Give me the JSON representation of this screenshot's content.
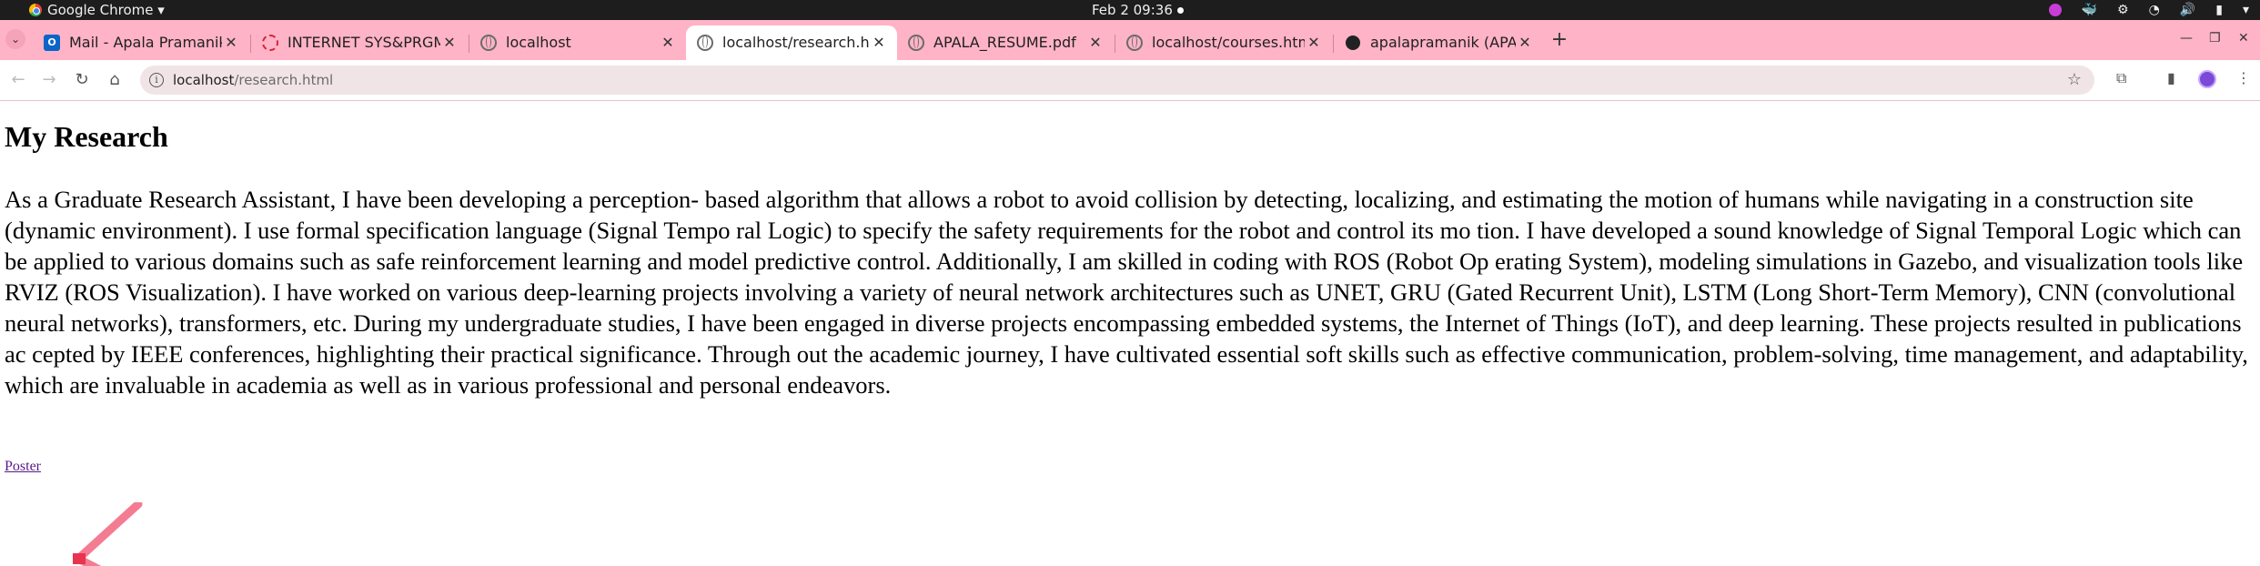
{
  "system_bar": {
    "app_name": "Google Chrome ▾",
    "clock": "Feb 2  09:36"
  },
  "tabs": [
    {
      "title": "Mail - Apala Pramanik - O",
      "icon": "outlook-icon"
    },
    {
      "title": "INTERNET SYS&PRGMMI",
      "icon": "ring-icon"
    },
    {
      "title": "localhost",
      "icon": "globe-icon"
    },
    {
      "title": "localhost/research.html",
      "icon": "globe-icon",
      "active": true
    },
    {
      "title": "APALA_RESUME.pdf",
      "icon": "globe-icon"
    },
    {
      "title": "localhost/courses.html",
      "icon": "globe-icon"
    },
    {
      "title": "apalapramanik (APALA P",
      "icon": "github-icon"
    }
  ],
  "toolbar": {
    "url_host": "localhost",
    "url_path": "/research.html"
  },
  "page": {
    "title": "My Research",
    "paragraph": "As a Graduate Research Assistant, I have been developing a perception- based algorithm that allows a robot to avoid collision by detecting, localizing, and estimating the motion of humans while navigating in a construction site (dynamic environment). I use formal specification language (Signal Tempo ral Logic) to specify the safety requirements for the robot and control its mo tion. I have developed a sound knowledge of Signal Temporal Logic which can be applied to various domains such as safe reinforcement learning and model predictive control. Additionally, I am skilled in coding with ROS (Robot Op erating System), modeling simulations in Gazebo, and visualization tools like RVIZ (ROS Visualization). I have worked on various deep-learning projects involving a variety of neural network architectures such as UNET, GRU (Gated Recurrent Unit), LSTM (Long Short-Term Memory), CNN (convolutional neural networks), transformers, etc. During my undergraduate studies, I have been engaged in diverse projects encompassing embedded systems, the Internet of Things (IoT), and deep learning. These projects resulted in publications ac cepted by IEEE conferences, highlighting their practical significance. Through out the academic journey, I have cultivated essential soft skills such as effective communication, problem-solving, time management, and adaptability, which are invaluable in academia as well as in various professional and personal endeavors.",
    "poster_link": "Poster"
  },
  "colors": {
    "tab_strip": "#ffb3c7",
    "omnibox": "#f1e4e7",
    "visited_link": "#551a8b",
    "annotation_arrow": "#f0506e"
  }
}
